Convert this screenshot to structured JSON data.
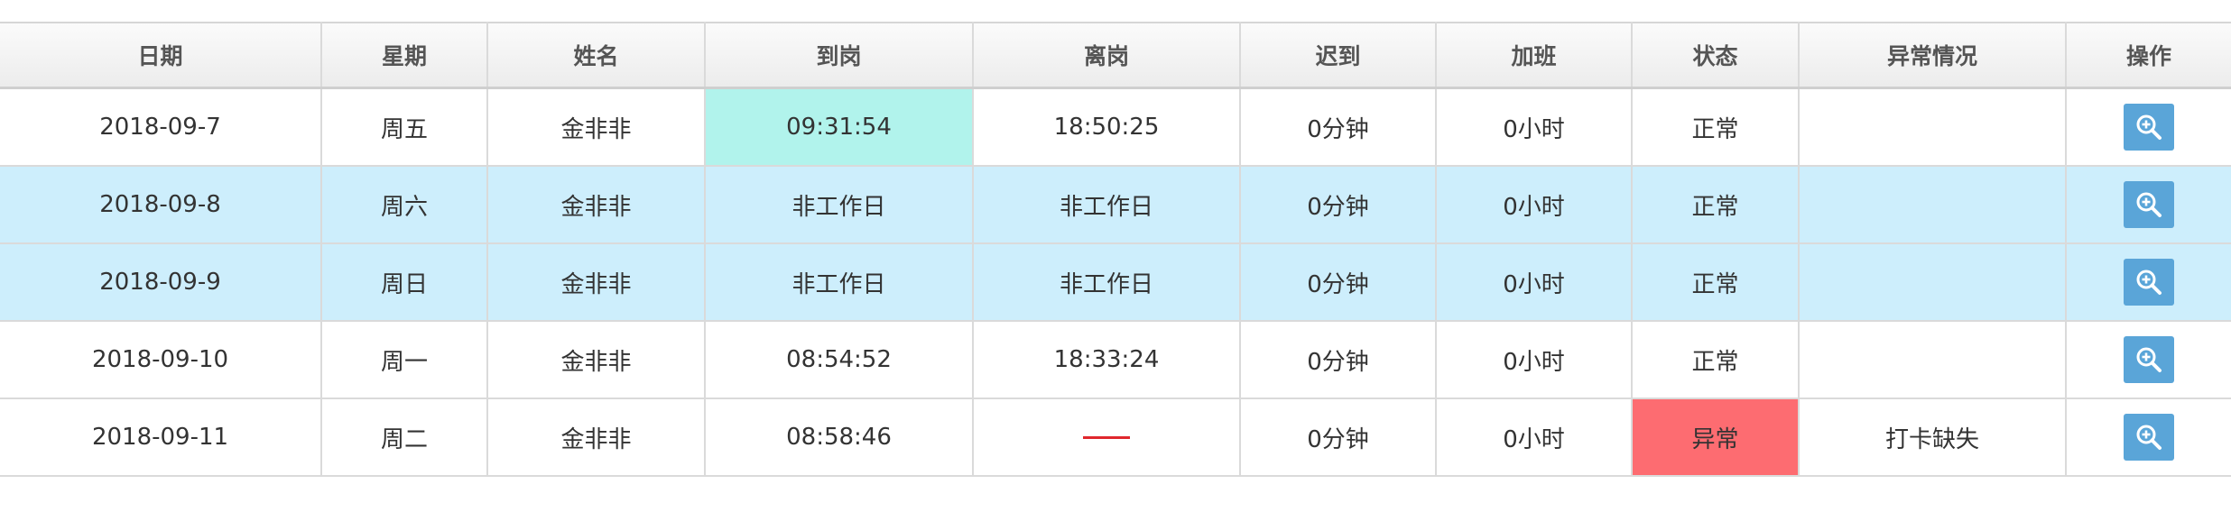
{
  "table": {
    "headers": [
      "日期",
      "星期",
      "姓名",
      "到岗",
      "离岗",
      "迟到",
      "加班",
      "状态",
      "异常情况",
      "操作"
    ],
    "rows": [
      {
        "date": "2018-09-7",
        "weekday": "周五",
        "name": "金非非",
        "arrive": "09:31:54",
        "leave": "18:50:25",
        "late": "0分钟",
        "overtime": "0小时",
        "status": "正常",
        "exception": ""
      },
      {
        "date": "2018-09-8",
        "weekday": "周六",
        "name": "金非非",
        "arrive": "非工作日",
        "leave": "非工作日",
        "late": "0分钟",
        "overtime": "0小时",
        "status": "正常",
        "exception": ""
      },
      {
        "date": "2018-09-9",
        "weekday": "周日",
        "name": "金非非",
        "arrive": "非工作日",
        "leave": "非工作日",
        "late": "0分钟",
        "overtime": "0小时",
        "status": "正常",
        "exception": ""
      },
      {
        "date": "2018-09-10",
        "weekday": "周一",
        "name": "金非非",
        "arrive": "08:54:52",
        "leave": "18:33:24",
        "late": "0分钟",
        "overtime": "0小时",
        "status": "正常",
        "exception": ""
      },
      {
        "date": "2018-09-11",
        "weekday": "周二",
        "name": "金非非",
        "arrive": "08:58:46",
        "leave": "——",
        "late": "0分钟",
        "overtime": "0小时",
        "status": "异常",
        "exception": "打卡缺失"
      }
    ],
    "action_icon": "zoom-in-icon"
  },
  "colors": {
    "late_arrival_highlight": "#b1f3ec",
    "weekend_row": "#cdeefc",
    "abnormal_status": "#fd6c71",
    "action_button": "#5aa5d8",
    "missing_dash": "#e0272d"
  }
}
